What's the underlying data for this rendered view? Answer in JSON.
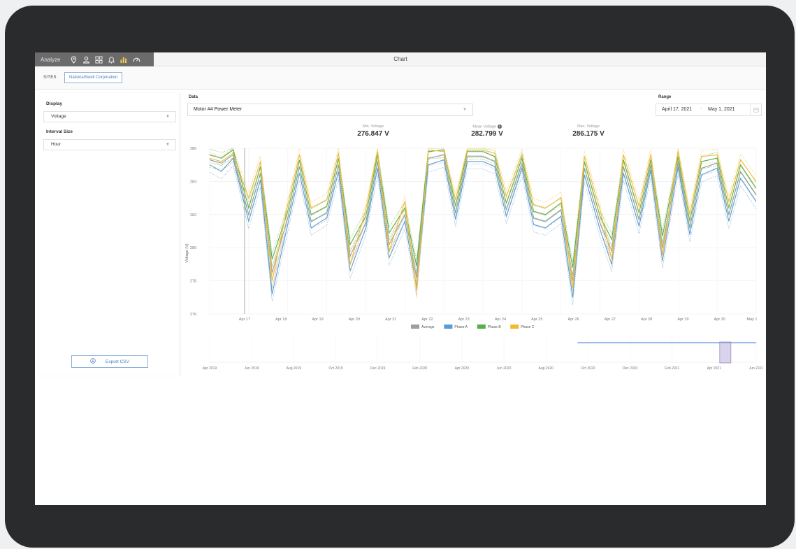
{
  "topbar": {
    "section_label": "Analyze",
    "title": "Chart",
    "icons": [
      "location-pin-icon",
      "user-icon",
      "dashboard-grid-icon",
      "bell-icon",
      "bar-chart-icon",
      "gauge-icon"
    ]
  },
  "sites": {
    "label": "SITES",
    "selected": "NationalSwell Corporation"
  },
  "left_panel": {
    "display_label": "Display",
    "display_value": "Voltage",
    "interval_label": "Interval Size",
    "interval_value": "Hour",
    "export_label": "Export CSV"
  },
  "data_selector": {
    "label": "Data",
    "value": "Motor #4 Power Meter"
  },
  "range": {
    "label": "Range",
    "start": "April 17, 2021",
    "separator": "-",
    "end": "May 1, 2021"
  },
  "stats": {
    "min_label": "Min. Voltage",
    "min_value": "276.847 V",
    "mean_label": "Mean Voltage",
    "mean_value": "282.799 V",
    "max_label": "Max. Voltage",
    "max_value": "286.175 V"
  },
  "colors": {
    "average": "#9e9e9e",
    "phase_a": "#5b9bd5",
    "phase_b": "#55b04a",
    "phase_c": "#f2b933",
    "navigator": "#3a7bd5",
    "window": "#b9b0dd"
  },
  "chart_data": {
    "type": "line",
    "ylabel": "Voltage (V)",
    "ylim": [
      276,
      286
    ],
    "yticks": [
      276,
      278,
      280,
      282,
      284,
      286
    ],
    "x_tick_labels": [
      "Apr 17",
      "Apr 18",
      "Apr 19",
      "Apr 20",
      "Apr 21",
      "Apr 22",
      "Apr 23",
      "Apr 24",
      "Apr 25",
      "Apr 26",
      "Apr 27",
      "Apr 28",
      "Apr 29",
      "Apr 30",
      "May 1"
    ],
    "x_days": [
      0,
      1,
      2,
      3,
      4,
      5,
      6,
      7,
      8,
      9,
      10,
      11,
      12,
      13,
      14
    ],
    "legend": [
      "Average",
      "Phase A",
      "Phase B",
      "Phase C"
    ],
    "legend_position": "bottom",
    "grid": true,
    "series": [
      {
        "name": "Average",
        "x": [
          0,
          0.3,
          0.6,
          1,
          1.3,
          1.6,
          2,
          2.3,
          2.6,
          3,
          3.3,
          3.6,
          4,
          4.3,
          4.6,
          5,
          5.3,
          5.6,
          6,
          6.3,
          6.6,
          7,
          7.3,
          7.6,
          8,
          8.3,
          8.6,
          9,
          9.3,
          9.6,
          10,
          10.3,
          10.6,
          11,
          11.3,
          11.6,
          12,
          12.3,
          12.6,
          13,
          13.3,
          13.6,
          14
        ],
        "y": [
          285.3,
          285.1,
          285.6,
          282.0,
          284.5,
          278.5,
          281.8,
          284.9,
          281.6,
          282.1,
          285.0,
          279.5,
          281.5,
          285.2,
          280.2,
          282.0,
          278.2,
          285.4,
          285.6,
          282.1,
          285.5,
          285.5,
          285.2,
          282.3,
          285.1,
          281.8,
          281.6,
          282.3,
          278.0,
          284.8,
          281.5,
          279.8,
          284.9,
          281.7,
          285.0,
          280.0,
          285.2,
          281.2,
          284.8,
          285.1,
          282.0,
          284.6,
          283.2
        ]
      },
      {
        "name": "Phase A",
        "x": [
          0,
          0.3,
          0.6,
          1,
          1.3,
          1.6,
          2,
          2.3,
          2.6,
          3,
          3.3,
          3.6,
          4,
          4.3,
          4.6,
          5,
          5.3,
          5.6,
          6,
          6.3,
          6.6,
          7,
          7.3,
          7.6,
          8,
          8.3,
          8.6,
          9,
          9.3,
          9.6,
          10,
          10.3,
          10.6,
          11,
          11.3,
          11.6,
          12,
          12.3,
          12.6,
          13,
          13.3,
          13.6,
          14
        ],
        "y": [
          285.0,
          284.6,
          285.4,
          281.6,
          284.1,
          277.2,
          281.4,
          284.5,
          281.2,
          281.8,
          284.6,
          278.6,
          281.2,
          284.8,
          279.4,
          281.6,
          277.6,
          285.0,
          285.3,
          281.7,
          285.2,
          285.2,
          284.9,
          281.9,
          284.8,
          281.4,
          281.2,
          281.9,
          277.0,
          284.4,
          281.1,
          279.0,
          284.5,
          281.3,
          284.7,
          279.2,
          284.9,
          280.8,
          284.4,
          284.8,
          281.6,
          284.2,
          282.8
        ]
      },
      {
        "name": "Phase B",
        "x": [
          0,
          0.3,
          0.6,
          1,
          1.3,
          1.6,
          2,
          2.3,
          2.6,
          3,
          3.3,
          3.6,
          4,
          4.3,
          4.6,
          5,
          5.3,
          5.6,
          6,
          6.3,
          6.6,
          7,
          7.3,
          7.6,
          8,
          8.3,
          8.6,
          9,
          9.3,
          9.6,
          10,
          10.3,
          10.6,
          11,
          11.3,
          11.6,
          12,
          12.3,
          12.6,
          13,
          13.3,
          13.6,
          14
        ],
        "y": [
          285.6,
          285.4,
          285.9,
          282.4,
          284.9,
          279.3,
          282.2,
          285.3,
          282.0,
          282.5,
          285.4,
          280.2,
          281.9,
          285.6,
          280.9,
          282.4,
          278.9,
          285.8,
          285.9,
          282.5,
          285.8,
          285.8,
          285.5,
          282.7,
          285.4,
          282.2,
          282.0,
          282.7,
          278.8,
          285.2,
          281.9,
          280.5,
          285.3,
          282.1,
          285.3,
          280.7,
          285.5,
          281.6,
          285.2,
          285.4,
          282.4,
          285.0,
          283.6
        ]
      },
      {
        "name": "Phase C",
        "x": [
          0,
          0.3,
          0.6,
          1,
          1.3,
          1.6,
          2,
          2.3,
          2.6,
          3,
          3.3,
          3.6,
          4,
          4.3,
          4.6,
          5,
          5.3,
          5.6,
          6,
          6.3,
          6.6,
          7,
          7.3,
          7.6,
          8,
          8.3,
          8.6,
          9,
          9.3,
          9.6,
          10,
          10.3,
          10.6,
          11,
          11.3,
          11.6,
          12,
          12.3,
          12.6,
          13,
          13.3,
          13.6,
          14
        ],
        "y": [
          285.4,
          285.2,
          285.7,
          283.0,
          285.2,
          278.0,
          282.6,
          285.6,
          282.4,
          282.9,
          285.7,
          279.0,
          282.3,
          285.8,
          279.8,
          282.8,
          277.4,
          285.9,
          285.8,
          282.9,
          285.9,
          285.9,
          285.7,
          283.1,
          285.6,
          282.6,
          282.4,
          283.0,
          277.6,
          285.5,
          282.3,
          279.3,
          285.6,
          282.5,
          285.6,
          279.6,
          285.8,
          282.0,
          285.5,
          285.6,
          282.8,
          285.3,
          284.0
        ]
      }
    ],
    "navigator": {
      "x_tick_labels": [
        "Apr 2019",
        "Jun 2019",
        "Aug 2019",
        "Oct 2019",
        "Dec 2019",
        "Feb 2020",
        "Apr 2020",
        "Jun 2020",
        "Aug 2020",
        "Oct 2020",
        "Dec 2020",
        "Feb 2021",
        "Apr 2021",
        "Jun 2021"
      ],
      "data_start": "Oct 2020",
      "selected_range": [
        "Apr 17, 2021",
        "May 1, 2021"
      ]
    }
  }
}
